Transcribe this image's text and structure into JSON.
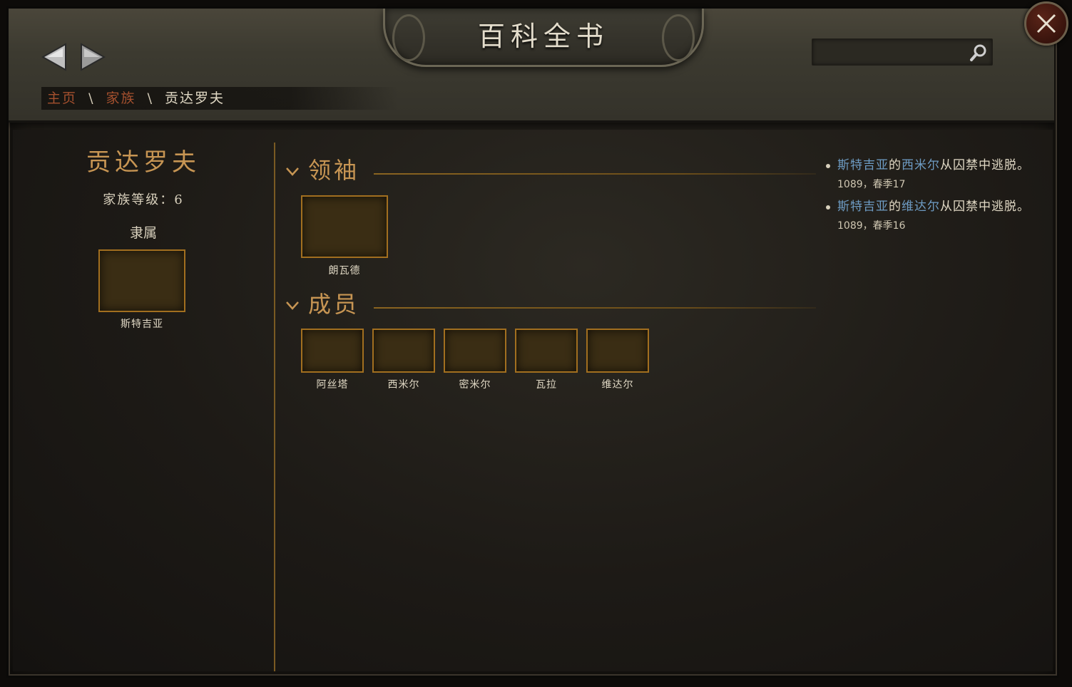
{
  "window": {
    "title": "百科全书"
  },
  "search": {
    "placeholder": "",
    "value": ""
  },
  "breadcrumb": {
    "home": "主页",
    "sep1": "\\",
    "category": "家族",
    "sep2": "\\",
    "current": "贡达罗夫"
  },
  "clan": {
    "name": "贡达罗夫",
    "tier_label": "家族等级：6",
    "vassal_label": "隶属",
    "vassal_of": "斯特吉亚"
  },
  "leader_section": {
    "title": "领袖",
    "leader": "朗瓦德"
  },
  "members_section": {
    "title": "成员",
    "members": [
      "阿丝塔",
      "西米尔",
      "密米尔",
      "瓦拉",
      "维达尔"
    ]
  },
  "events": [
    {
      "faction": "斯特吉亚",
      "connector": "的",
      "person": "西米尔",
      "text": "从囚禁中逃脱。",
      "date": "1089，春季17"
    },
    {
      "faction": "斯特吉亚",
      "connector": "的",
      "person": "维达尔",
      "text": "从囚禁中逃脱。",
      "date": "1089，春季16"
    }
  ],
  "icons": {
    "back": "triangle-left-icon",
    "forward": "triangle-right-icon",
    "search": "magnifier-icon",
    "close": "x-icon",
    "collapse": "chevron-down-icon"
  },
  "colors": {
    "accent_gold": "#c79553",
    "link_blue": "#6e9cc4",
    "crumb_link": "#a4502e",
    "portrait_border": "#a26f1f"
  }
}
